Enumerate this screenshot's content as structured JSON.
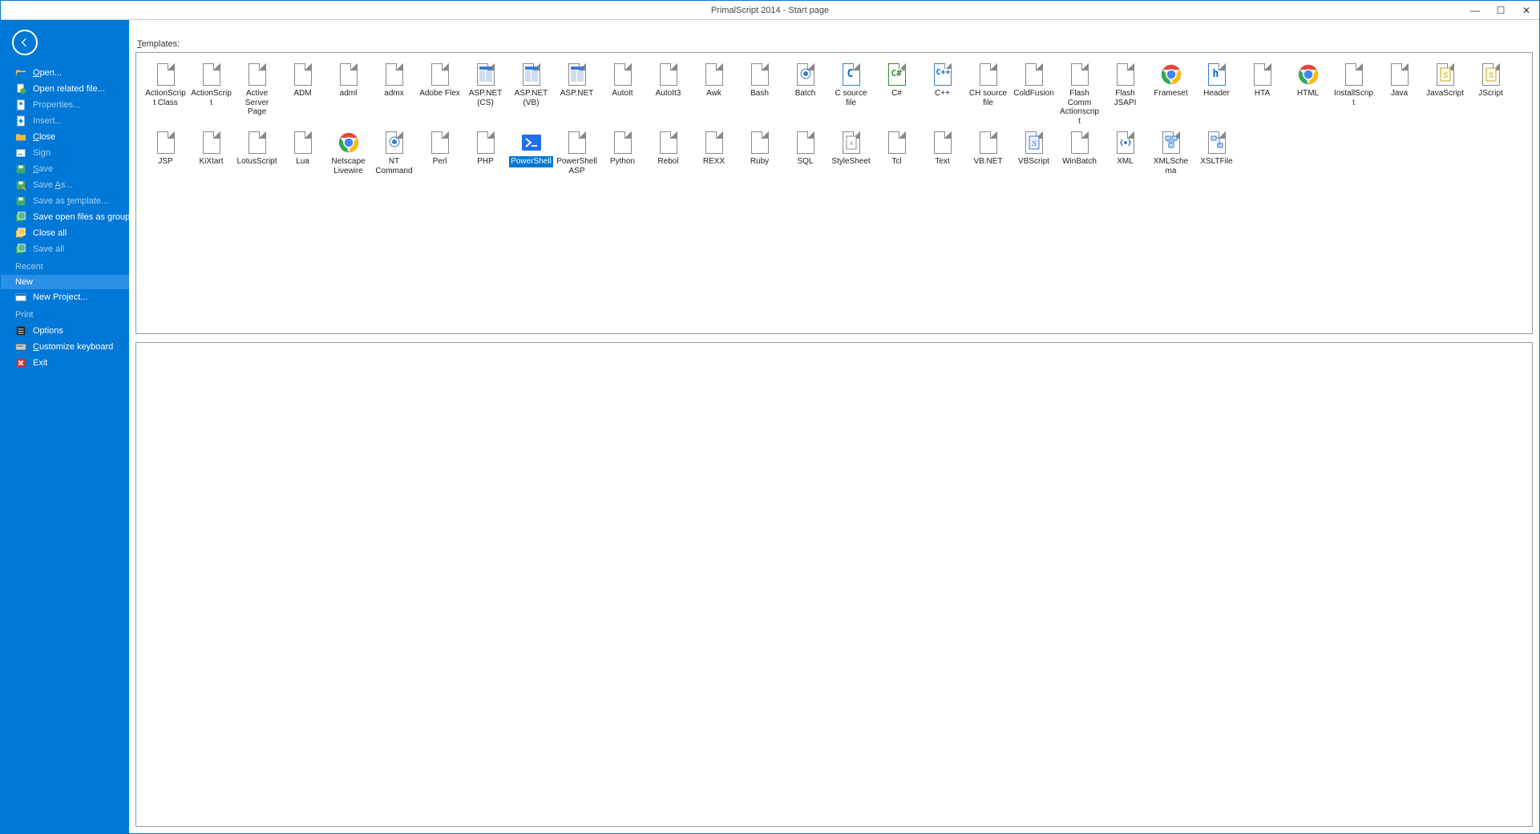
{
  "title": "PrimalScript 2014 - Start page",
  "sidebar": {
    "items": [
      {
        "label": "Open...",
        "icon": "folder-open",
        "dim": false,
        "ul": "O"
      },
      {
        "label": "Open related file...",
        "icon": "doc-refresh",
        "dim": false,
        "ul": ""
      },
      {
        "label": "Properties...",
        "icon": "properties",
        "dim": true,
        "ul": ""
      },
      {
        "label": "Insert...",
        "icon": "insert",
        "dim": true,
        "ul": ""
      },
      {
        "label": "Close",
        "icon": "folder-close",
        "dim": false,
        "ul": "C"
      },
      {
        "label": "Sign",
        "icon": "sign",
        "dim": true,
        "ul": ""
      },
      {
        "label": "Save",
        "icon": "save",
        "dim": true,
        "ul": "S"
      },
      {
        "label": "Save As...",
        "icon": "save-as",
        "dim": true,
        "ul": "A"
      },
      {
        "label": "Save as template...",
        "icon": "save-tpl",
        "dim": true,
        "ul": "t"
      },
      {
        "label": "Save open files as group...",
        "icon": "save-group",
        "dim": false,
        "ul": ""
      },
      {
        "label": "Close all",
        "icon": "close-all",
        "dim": false,
        "ul": ""
      },
      {
        "label": "Save all",
        "icon": "save-all",
        "dim": true,
        "ul": ""
      }
    ],
    "sections": {
      "recent": "Recent",
      "new": "New",
      "print": "Print"
    },
    "newProject": "New Project...",
    "options": "Options",
    "customize": "Customize keyboard",
    "exit": "Exit"
  },
  "templates": {
    "label": "Templates:",
    "items": [
      {
        "name": "ActionScript Class",
        "icon": "file"
      },
      {
        "name": "ActionScript",
        "icon": "file"
      },
      {
        "name": "Active Server Page",
        "icon": "file"
      },
      {
        "name": "ADM",
        "icon": "file"
      },
      {
        "name": "adml",
        "icon": "file"
      },
      {
        "name": "admx",
        "icon": "file"
      },
      {
        "name": "Adobe Flex",
        "icon": "file"
      },
      {
        "name": "ASP.NET (CS)",
        "icon": "aspnet"
      },
      {
        "name": "ASP.NET (VB)",
        "icon": "aspnet"
      },
      {
        "name": "ASP.NET",
        "icon": "aspnet"
      },
      {
        "name": "AutoIt",
        "icon": "file"
      },
      {
        "name": "AutoIt3",
        "icon": "file"
      },
      {
        "name": "Awk",
        "icon": "file"
      },
      {
        "name": "Bash",
        "icon": "file"
      },
      {
        "name": "Batch",
        "icon": "batch"
      },
      {
        "name": "C source file",
        "icon": "c"
      },
      {
        "name": "C#",
        "icon": "csharp"
      },
      {
        "name": "C++",
        "icon": "cpp"
      },
      {
        "name": "CH source file",
        "icon": "file"
      },
      {
        "name": "ColdFusion",
        "icon": "file"
      },
      {
        "name": "Flash Comm Actionscript",
        "icon": "file"
      },
      {
        "name": "Flash JSAPI",
        "icon": "file"
      },
      {
        "name": "Frameset",
        "icon": "chrome"
      },
      {
        "name": "Header",
        "icon": "header"
      },
      {
        "name": "HTA",
        "icon": "file"
      },
      {
        "name": "HTML",
        "icon": "chrome"
      },
      {
        "name": "InstallScript",
        "icon": "file"
      },
      {
        "name": "Java",
        "icon": "file"
      },
      {
        "name": "JavaScript",
        "icon": "js"
      },
      {
        "name": "JScript",
        "icon": "js"
      },
      {
        "name": "JSP",
        "icon": "file"
      },
      {
        "name": "KiXtart",
        "icon": "file"
      },
      {
        "name": "LotusScript",
        "icon": "file"
      },
      {
        "name": "Lua",
        "icon": "file"
      },
      {
        "name": "Netscape Livewire",
        "icon": "chrome"
      },
      {
        "name": "NT Command",
        "icon": "batch"
      },
      {
        "name": "Perl",
        "icon": "file"
      },
      {
        "name": "PHP",
        "icon": "file"
      },
      {
        "name": "PowerShell",
        "icon": "powershell",
        "selected": true
      },
      {
        "name": "PowerShellASP",
        "icon": "file"
      },
      {
        "name": "Python",
        "icon": "file"
      },
      {
        "name": "Rebol",
        "icon": "file"
      },
      {
        "name": "REXX",
        "icon": "file"
      },
      {
        "name": "Ruby",
        "icon": "file"
      },
      {
        "name": "SQL",
        "icon": "file"
      },
      {
        "name": "StyleSheet",
        "icon": "css"
      },
      {
        "name": "Tcl",
        "icon": "file"
      },
      {
        "name": "Text",
        "icon": "file"
      },
      {
        "name": "VB.NET",
        "icon": "file"
      },
      {
        "name": "VBScript",
        "icon": "vbs"
      },
      {
        "name": "WinBatch",
        "icon": "file"
      },
      {
        "name": "XML",
        "icon": "xml"
      },
      {
        "name": "XMLSchema",
        "icon": "xmlschema"
      },
      {
        "name": "XSLTFile",
        "icon": "xslt"
      }
    ]
  }
}
